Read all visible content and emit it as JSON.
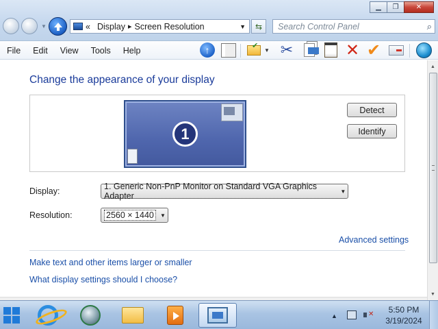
{
  "window": {
    "minimize_icon": "minimize-icon",
    "maximize_icon": "maximize-icon",
    "close_icon": "close-icon"
  },
  "address": {
    "prefix": "«",
    "crumbs": [
      "Display",
      "Screen Resolution"
    ],
    "separator": "▸"
  },
  "search": {
    "placeholder": "Search Control Panel"
  },
  "menu": [
    "File",
    "Edit",
    "View",
    "Tools",
    "Help"
  ],
  "content": {
    "heading": "Change the appearance of your display",
    "monitor_number": "1",
    "detect_label": "Detect",
    "identify_label": "Identify",
    "display_label": "Display:",
    "display_value": "1. Generic Non-PnP Monitor on Standard VGA Graphics Adapter",
    "resolution_label": "Resolution:",
    "resolution_value": "2560 × 1440",
    "advanced_link": "Advanced settings",
    "larger_link": "Make text and other items larger or smaller",
    "which_link": "What display settings should I choose?"
  },
  "taskbar": {
    "apps": [
      "internet-explorer",
      "windows-media-player",
      "windows-explorer",
      "media-center",
      "control-panel"
    ],
    "active_app": "control-panel",
    "time": "5:50 PM",
    "date": "3/19/2024"
  },
  "colors": {
    "heading": "#1a3b9a",
    "link": "#1a4fa8",
    "monitor": "#5c72b6",
    "start": "#1f7ad8"
  }
}
